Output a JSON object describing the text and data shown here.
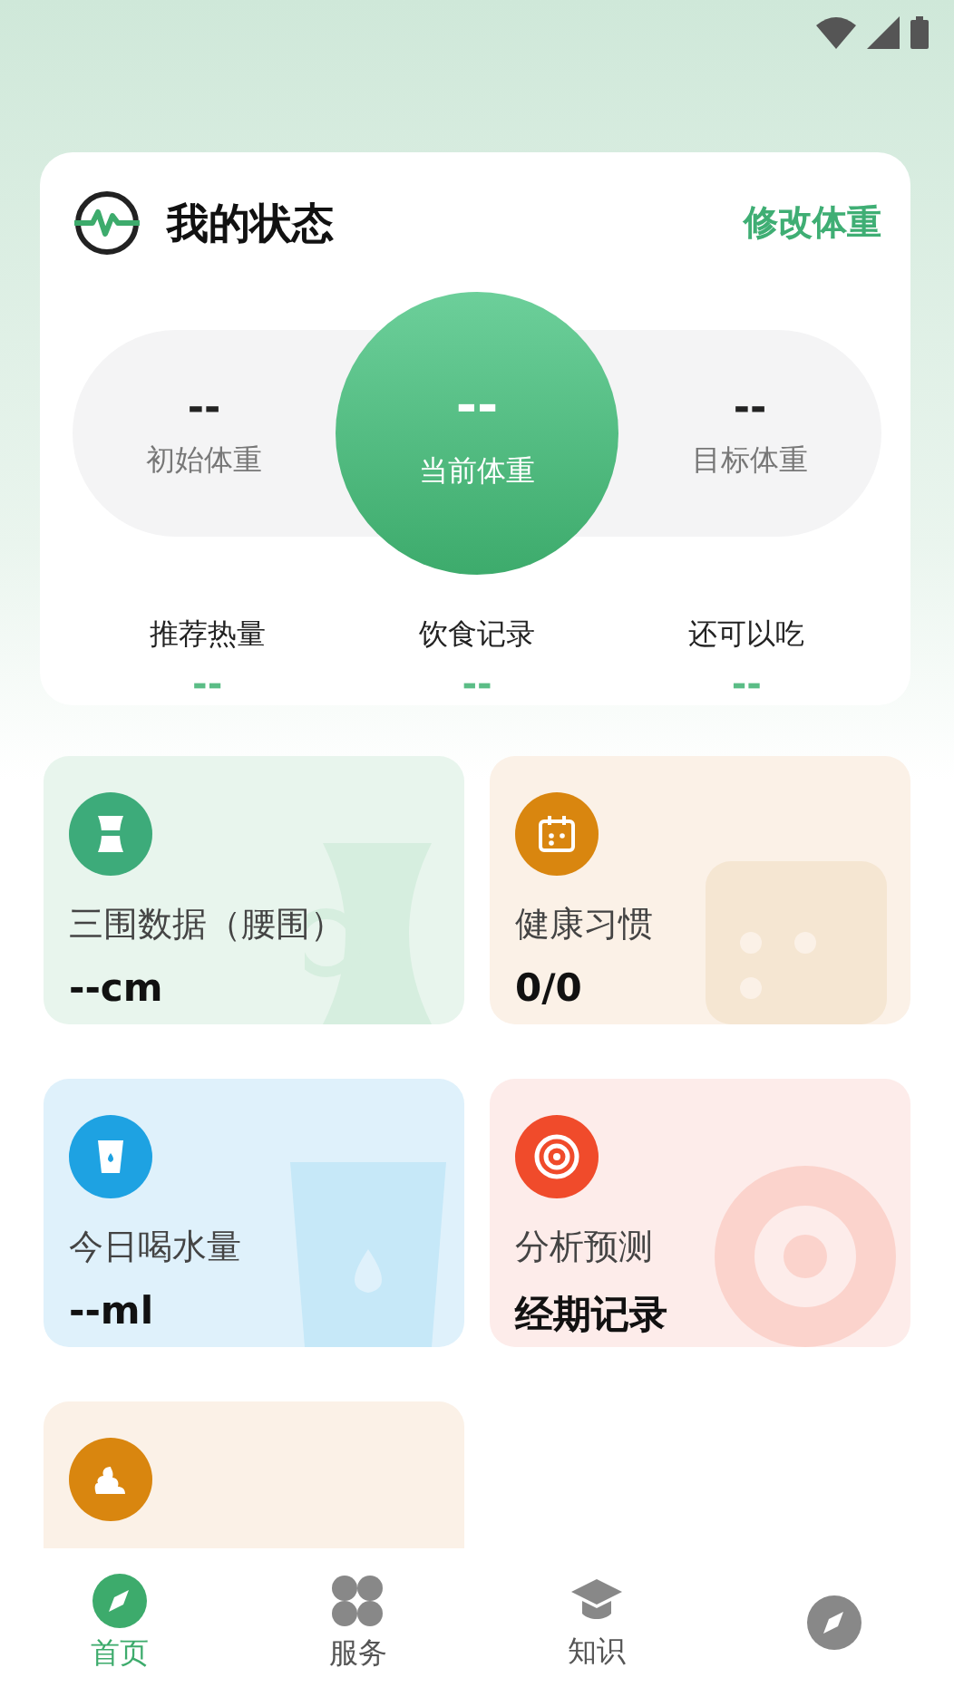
{
  "status_card": {
    "title": "我的状态",
    "action": "修改体重",
    "weights": [
      {
        "kind": "side",
        "value": "--",
        "label": "初始体重"
      },
      {
        "kind": "center",
        "value": "--",
        "label": "当前体重"
      },
      {
        "kind": "side",
        "value": "--",
        "label": "目标体重"
      }
    ],
    "stats": [
      {
        "label": "推荐热量",
        "value": "--"
      },
      {
        "label": "饮食记录",
        "value": "--"
      },
      {
        "label": "还可以吃",
        "value": "--"
      }
    ]
  },
  "tiles": [
    {
      "kind": "waist",
      "title": "三围数据（腰围）",
      "value": "--cm"
    },
    {
      "kind": "habit",
      "title": "健康习惯",
      "value": "0/0"
    },
    {
      "kind": "water",
      "title": "今日喝水量",
      "value": "--ml"
    },
    {
      "kind": "period",
      "title": "分析预测",
      "value": "经期记录"
    },
    {
      "kind": "stool"
    }
  ],
  "nav": [
    {
      "kind": "home",
      "label": "首页",
      "selected": true
    },
    {
      "kind": "service",
      "label": "服务",
      "selected": false
    },
    {
      "kind": "knowledge",
      "label": "知识",
      "selected": false
    },
    {
      "kind": "discover",
      "selected": false
    }
  ]
}
